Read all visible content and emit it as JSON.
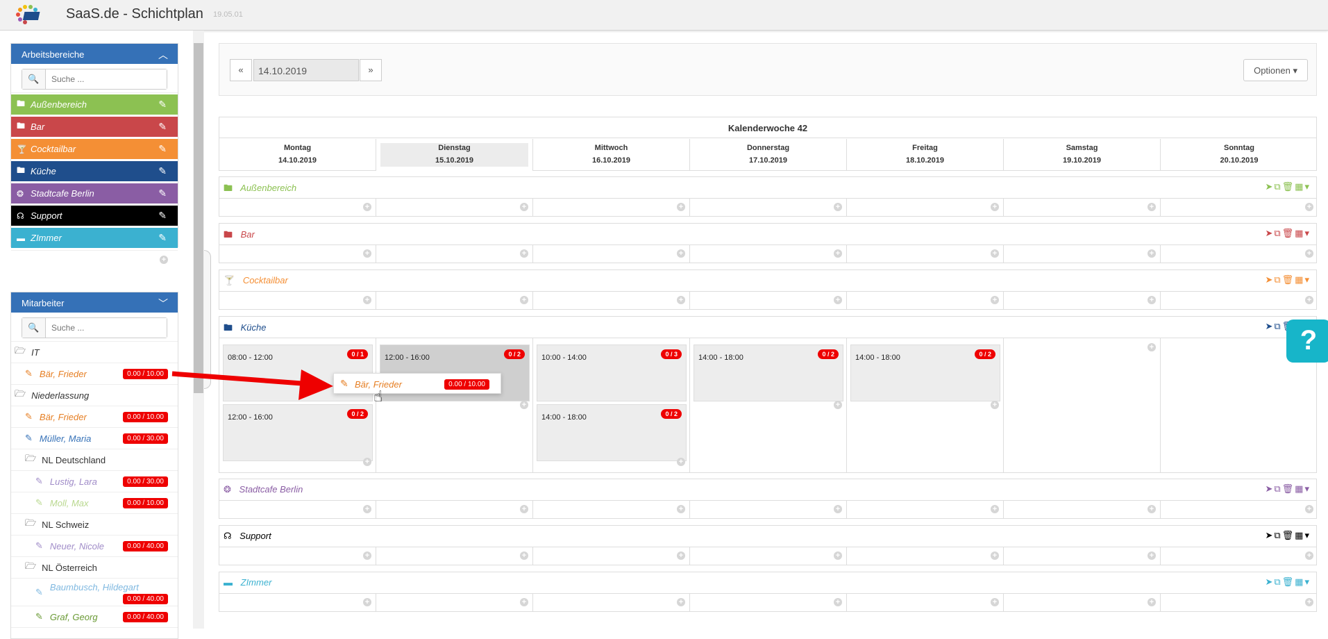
{
  "app": {
    "title": "SaaS.de - Schichtplan",
    "version": "19.05.01"
  },
  "areas_panel": {
    "title": "Arbeitsbereiche",
    "search_placeholder": "Suche ...",
    "items": [
      {
        "label": "Außenbereich",
        "color": "#8cc152",
        "icon": "folder-icon"
      },
      {
        "label": "Bar",
        "color": "#c9474a",
        "icon": "folder-icon"
      },
      {
        "label": "Cocktailbar",
        "color": "#f48f35",
        "icon": "cocktail-icon"
      },
      {
        "label": "Küche",
        "color": "#1f4e8c",
        "icon": "folder-icon"
      },
      {
        "label": "Stadtcafe Berlin",
        "color": "#8a5da4",
        "icon": "balloon-icon"
      },
      {
        "label": "Support",
        "color": "#000000",
        "icon": "headset-icon"
      },
      {
        "label": "ZImmer",
        "color": "#3bb1d0",
        "icon": "bed-icon"
      }
    ]
  },
  "staff_panel": {
    "title": "Mitarbeiter",
    "search_placeholder": "Suche ...",
    "rows": [
      {
        "type": "group",
        "label": "IT",
        "indent": 0
      },
      {
        "type": "emp",
        "label": "Bär, Frieder",
        "hours": "0.00 / 10.00",
        "color": "#e67e22",
        "indent": 1
      },
      {
        "type": "group",
        "label": "Niederlassung",
        "indent": 0
      },
      {
        "type": "emp",
        "label": "Bär, Frieder",
        "hours": "0.00 / 10.00",
        "color": "#e67e22",
        "indent": 1
      },
      {
        "type": "emp",
        "label": "Müller, Maria",
        "hours": "0.00 / 30.00",
        "color": "#3571b7",
        "indent": 1
      },
      {
        "type": "group",
        "label": "NL Deutschland",
        "indent": 1
      },
      {
        "type": "emp",
        "label": "Lustig, Lara",
        "hours": "0.00 / 30.00",
        "color": "#a08cc8",
        "indent": 2
      },
      {
        "type": "emp",
        "label": "Moll, Max",
        "hours": "0.00 / 10.00",
        "color": "#b9d88f",
        "indent": 2
      },
      {
        "type": "group",
        "label": "NL Schweiz",
        "indent": 1
      },
      {
        "type": "emp",
        "label": "Neuer, Nicole",
        "hours": "0.00 / 40.00",
        "color": "#a08cc8",
        "indent": 2
      },
      {
        "type": "group",
        "label": "NL Österreich",
        "indent": 1
      },
      {
        "type": "emp",
        "label": "Baumbusch, Hildegart",
        "hours": "0.00 / 40.00",
        "color": "#7fb8e0",
        "indent": 2
      },
      {
        "type": "emp",
        "label": "Graf, Georg",
        "hours": "0.00 / 40.00",
        "color": "#6a9a35",
        "indent": 2
      }
    ]
  },
  "toolbar": {
    "prev": "«",
    "date": "14.10.2019",
    "next": "»",
    "options": "Optionen"
  },
  "week": {
    "title": "Kalenderwoche 42",
    "days": [
      {
        "name": "Montag",
        "date": "14.10.2019"
      },
      {
        "name": "Dienstag",
        "date": "15.10.2019"
      },
      {
        "name": "Mittwoch",
        "date": "16.10.2019"
      },
      {
        "name": "Donnerstag",
        "date": "17.10.2019"
      },
      {
        "name": "Freitag",
        "date": "18.10.2019"
      },
      {
        "name": "Samstag",
        "date": "19.10.2019"
      },
      {
        "name": "Sonntag",
        "date": "20.10.2019"
      }
    ]
  },
  "groups": [
    {
      "label": "Außenbereich",
      "color": "#8cc152"
    },
    {
      "label": "Bar",
      "color": "#c9474a"
    },
    {
      "label": "Cocktailbar",
      "color": "#f48f35"
    },
    {
      "label": "Küche",
      "color": "#1f4e8c"
    },
    {
      "label": "Stadtcafe Berlin",
      "color": "#8a5da4"
    },
    {
      "label": "Support",
      "color": "#000000"
    },
    {
      "label": "ZImmer",
      "color": "#3bb1d0"
    }
  ],
  "kitchen_shifts": [
    {
      "day": 0,
      "slot": 0,
      "time": "08:00 - 12:00",
      "count": "0 / 1"
    },
    {
      "day": 0,
      "slot": 1,
      "time": "12:00 - 16:00",
      "count": "0 / 2"
    },
    {
      "day": 1,
      "slot": 0,
      "time": "12:00 - 16:00",
      "count": "0 / 2"
    },
    {
      "day": 2,
      "slot": 0,
      "time": "10:00 - 14:00",
      "count": "0 / 3"
    },
    {
      "day": 2,
      "slot": 1,
      "time": "14:00 - 18:00",
      "count": "0 / 2"
    },
    {
      "day": 3,
      "slot": 0,
      "time": "14:00 - 18:00",
      "count": "0 / 2"
    },
    {
      "day": 4,
      "slot": 0,
      "time": "14:00 - 18:00",
      "count": "0 / 2"
    }
  ],
  "drag_ghost": {
    "label": "Bär, Frieder",
    "hours": "0.00 / 10.00"
  },
  "help_icon": "question-mark-icon"
}
